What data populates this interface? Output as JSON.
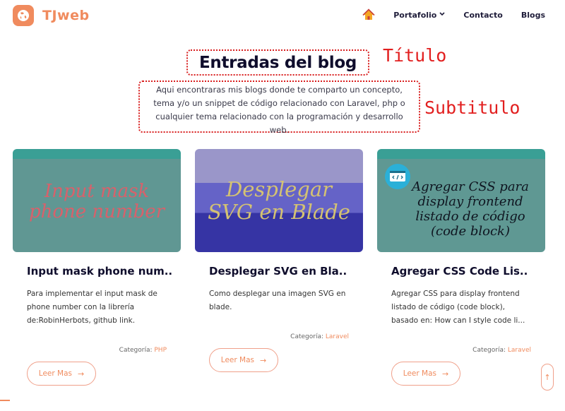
{
  "brand": {
    "name": "TJweb",
    "color": "#f08b5e",
    "logo_icon": "globe-logo-icon"
  },
  "nav": {
    "home_icon": "home-icon",
    "items": {
      "portfolio": "Portafolio",
      "contact": "Contacto",
      "blogs": "Blogs"
    }
  },
  "hero": {
    "title": "Entradas del blog",
    "subtitle": "Aqui encontraras mis blogs donde te comparto un concepto, tema y/o un snippet de código relacionado con Laravel, php o cualquier tema relacionado con la programación y desarrollo web.",
    "annotation_title": "Título",
    "annotation_subtitle": "Subtitulo",
    "annotation_color": "#e21f1f"
  },
  "cards": [
    {
      "image_text": "Input mask phone number",
      "title": "Input mask phone num..",
      "description": "Para implementar el input mask de phone number con la librería de:RobinHerbots, github link.",
      "category_label": "Categoría:",
      "category": "PHP",
      "button_label": "Leer Mas"
    },
    {
      "image_text": "Desplegar SVG en Blade",
      "title": "Desplegar SVG en Bla..",
      "description": "Como desplegar una imagen SVG en blade.",
      "category_label": "Categoría:",
      "category": "Laravel",
      "button_label": "Leer Mas"
    },
    {
      "image_text": "Agregar CSS para display frontend listado de código (code block)",
      "title": "Agregar CSS Code Lis..",
      "description": "Agregar CSS para display frontend listado de código (code block), basado en: How can I style code li...",
      "category_label": "Categoría:",
      "category": "Laravel",
      "button_label": "Leer Mas",
      "image_icon": "code-window-icon"
    }
  ],
  "scroll_top": {
    "icon": "arrow-up-icon"
  }
}
